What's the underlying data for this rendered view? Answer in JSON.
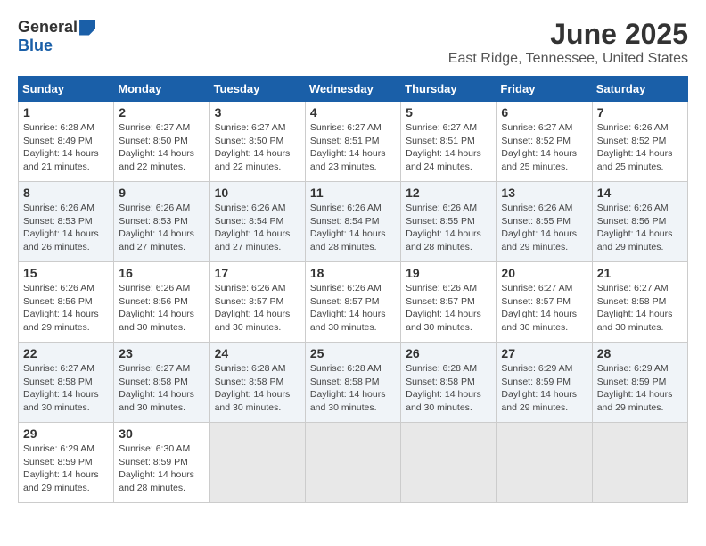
{
  "logo": {
    "general": "General",
    "blue": "Blue"
  },
  "title": "June 2025",
  "subtitle": "East Ridge, Tennessee, United States",
  "headers": [
    "Sunday",
    "Monday",
    "Tuesday",
    "Wednesday",
    "Thursday",
    "Friday",
    "Saturday"
  ],
  "weeks": [
    [
      {
        "day": "1",
        "info": "Sunrise: 6:28 AM\nSunset: 8:49 PM\nDaylight: 14 hours\nand 21 minutes."
      },
      {
        "day": "2",
        "info": "Sunrise: 6:27 AM\nSunset: 8:50 PM\nDaylight: 14 hours\nand 22 minutes."
      },
      {
        "day": "3",
        "info": "Sunrise: 6:27 AM\nSunset: 8:50 PM\nDaylight: 14 hours\nand 22 minutes."
      },
      {
        "day": "4",
        "info": "Sunrise: 6:27 AM\nSunset: 8:51 PM\nDaylight: 14 hours\nand 23 minutes."
      },
      {
        "day": "5",
        "info": "Sunrise: 6:27 AM\nSunset: 8:51 PM\nDaylight: 14 hours\nand 24 minutes."
      },
      {
        "day": "6",
        "info": "Sunrise: 6:27 AM\nSunset: 8:52 PM\nDaylight: 14 hours\nand 25 minutes."
      },
      {
        "day": "7",
        "info": "Sunrise: 6:26 AM\nSunset: 8:52 PM\nDaylight: 14 hours\nand 25 minutes."
      }
    ],
    [
      {
        "day": "8",
        "info": "Sunrise: 6:26 AM\nSunset: 8:53 PM\nDaylight: 14 hours\nand 26 minutes."
      },
      {
        "day": "9",
        "info": "Sunrise: 6:26 AM\nSunset: 8:53 PM\nDaylight: 14 hours\nand 27 minutes."
      },
      {
        "day": "10",
        "info": "Sunrise: 6:26 AM\nSunset: 8:54 PM\nDaylight: 14 hours\nand 27 minutes."
      },
      {
        "day": "11",
        "info": "Sunrise: 6:26 AM\nSunset: 8:54 PM\nDaylight: 14 hours\nand 28 minutes."
      },
      {
        "day": "12",
        "info": "Sunrise: 6:26 AM\nSunset: 8:55 PM\nDaylight: 14 hours\nand 28 minutes."
      },
      {
        "day": "13",
        "info": "Sunrise: 6:26 AM\nSunset: 8:55 PM\nDaylight: 14 hours\nand 29 minutes."
      },
      {
        "day": "14",
        "info": "Sunrise: 6:26 AM\nSunset: 8:56 PM\nDaylight: 14 hours\nand 29 minutes."
      }
    ],
    [
      {
        "day": "15",
        "info": "Sunrise: 6:26 AM\nSunset: 8:56 PM\nDaylight: 14 hours\nand 29 minutes."
      },
      {
        "day": "16",
        "info": "Sunrise: 6:26 AM\nSunset: 8:56 PM\nDaylight: 14 hours\nand 30 minutes."
      },
      {
        "day": "17",
        "info": "Sunrise: 6:26 AM\nSunset: 8:57 PM\nDaylight: 14 hours\nand 30 minutes."
      },
      {
        "day": "18",
        "info": "Sunrise: 6:26 AM\nSunset: 8:57 PM\nDaylight: 14 hours\nand 30 minutes."
      },
      {
        "day": "19",
        "info": "Sunrise: 6:26 AM\nSunset: 8:57 PM\nDaylight: 14 hours\nand 30 minutes."
      },
      {
        "day": "20",
        "info": "Sunrise: 6:27 AM\nSunset: 8:57 PM\nDaylight: 14 hours\nand 30 minutes."
      },
      {
        "day": "21",
        "info": "Sunrise: 6:27 AM\nSunset: 8:58 PM\nDaylight: 14 hours\nand 30 minutes."
      }
    ],
    [
      {
        "day": "22",
        "info": "Sunrise: 6:27 AM\nSunset: 8:58 PM\nDaylight: 14 hours\nand 30 minutes."
      },
      {
        "day": "23",
        "info": "Sunrise: 6:27 AM\nSunset: 8:58 PM\nDaylight: 14 hours\nand 30 minutes."
      },
      {
        "day": "24",
        "info": "Sunrise: 6:28 AM\nSunset: 8:58 PM\nDaylight: 14 hours\nand 30 minutes."
      },
      {
        "day": "25",
        "info": "Sunrise: 6:28 AM\nSunset: 8:58 PM\nDaylight: 14 hours\nand 30 minutes."
      },
      {
        "day": "26",
        "info": "Sunrise: 6:28 AM\nSunset: 8:58 PM\nDaylight: 14 hours\nand 30 minutes."
      },
      {
        "day": "27",
        "info": "Sunrise: 6:29 AM\nSunset: 8:59 PM\nDaylight: 14 hours\nand 29 minutes."
      },
      {
        "day": "28",
        "info": "Sunrise: 6:29 AM\nSunset: 8:59 PM\nDaylight: 14 hours\nand 29 minutes."
      }
    ],
    [
      {
        "day": "29",
        "info": "Sunrise: 6:29 AM\nSunset: 8:59 PM\nDaylight: 14 hours\nand 29 minutes."
      },
      {
        "day": "30",
        "info": "Sunrise: 6:30 AM\nSunset: 8:59 PM\nDaylight: 14 hours\nand 28 minutes."
      },
      {
        "day": "",
        "info": ""
      },
      {
        "day": "",
        "info": ""
      },
      {
        "day": "",
        "info": ""
      },
      {
        "day": "",
        "info": ""
      },
      {
        "day": "",
        "info": ""
      }
    ]
  ]
}
